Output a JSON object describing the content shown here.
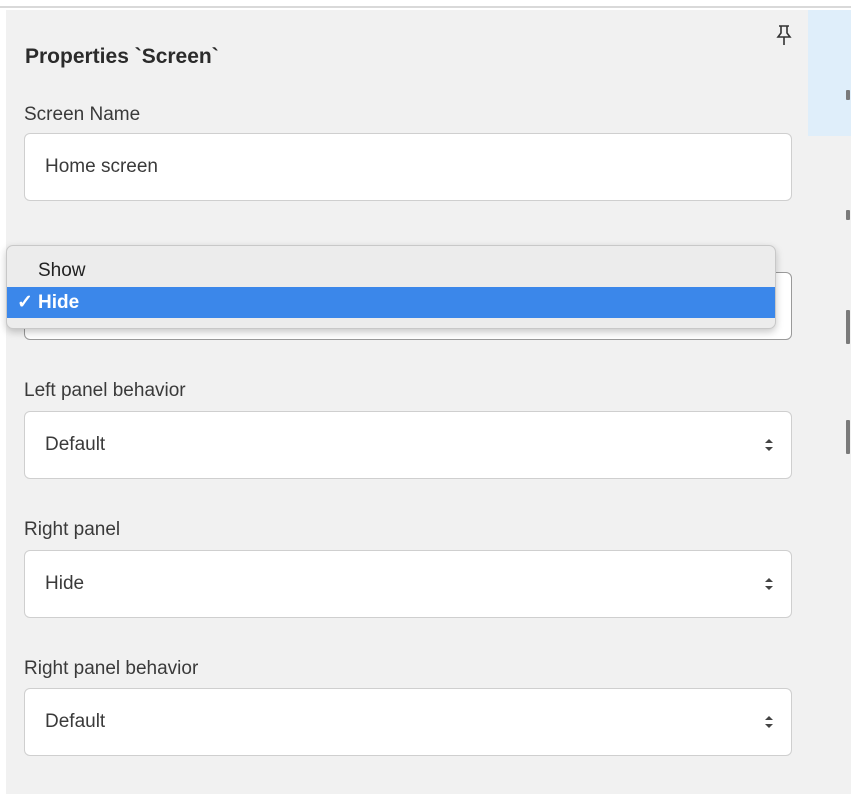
{
  "panel": {
    "title": "Properties `Screen`",
    "fields": {
      "screen_name": {
        "label": "Screen Name",
        "value": "Home screen"
      },
      "left_panel_behavior": {
        "label": "Left panel behavior",
        "value": "Default"
      },
      "right_panel": {
        "label": "Right panel",
        "value": "Hide"
      },
      "right_panel_behavior": {
        "label": "Right panel behavior",
        "value": "Default"
      }
    }
  },
  "dropdown": {
    "options": [
      {
        "label": "Show",
        "selected": false
      },
      {
        "label": "Hide",
        "selected": true
      }
    ],
    "check": "✓"
  },
  "icons": {
    "pin": "pin-icon",
    "select_caret": "updown-caret-icon"
  },
  "colors": {
    "panel_bg": "#f1f1f1",
    "selected_option": "#3b87ea",
    "right_strip_highlight": "#dfeefa"
  }
}
